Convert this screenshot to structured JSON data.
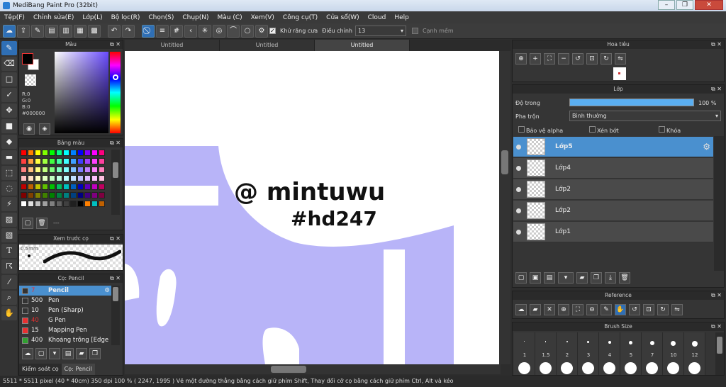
{
  "window": {
    "title": "MediBang Paint Pro (32bit)"
  },
  "menu": [
    "Tệp(F)",
    "Chỉnh sửa(E)",
    "Lớp(L)",
    "Bộ lọc(R)",
    "Chọn(S)",
    "Chụp(N)",
    "Màu (C)",
    "Xem(V)",
    "Công cụ(T)",
    "Cửa sổ(W)",
    "Cloud",
    "Help"
  ],
  "toolbar": {
    "antialias_label": "Khử răng cưa",
    "adjust_label": "Điều chỉnh",
    "adjust_value": "13",
    "edge_label": "Cạnh mềm"
  },
  "color_panel": {
    "title": "Màu",
    "r": "R:0",
    "g": "G:0",
    "b": "B:0",
    "hex": "#000000"
  },
  "palette_panel": {
    "title": "Bảng màu",
    "extra": "---"
  },
  "preview_panel": {
    "title": "Xem trước cọ",
    "size": "0.5mm"
  },
  "brush_panel": {
    "title": "Cọ: Pencil",
    "brushes": [
      {
        "size": "7",
        "name": "Pencil",
        "color": "#333333"
      },
      {
        "size": "500",
        "name": "Pen",
        "color": "#333333"
      },
      {
        "size": "10",
        "name": "Pen (Sharp)",
        "color": "#333333"
      },
      {
        "size": "40",
        "name": "G Pen",
        "color": "#e83030"
      },
      {
        "size": "15",
        "name": "Mapping Pen",
        "color": "#e83030"
      },
      {
        "size": "400",
        "name": "Khoảng trống [Edge",
        "color": "#30a030"
      }
    ],
    "bottom_tabs": [
      "Kiểm soát cọ",
      "Cọ: Pencil"
    ]
  },
  "tabs": [
    "Untitled",
    "Untitled",
    "Untitled"
  ],
  "canvas": {
    "text_line1": "@ mintuwu",
    "text_line2": "#hd247"
  },
  "navigator": {
    "title": "Hoa tiêu"
  },
  "layer_panel": {
    "title": "Lớp",
    "opacity_label": "Độ trong",
    "opacity_value": "100 %",
    "blend_label": "Pha trộn",
    "blend_value": "Bình thường",
    "protect_alpha": "Bảo vệ alpha",
    "clip": "Xén bớt",
    "lock": "Khóa",
    "layers": [
      "Lớp5",
      "Lớp4",
      "Lớp2",
      "Lớp2",
      "Lớp1"
    ]
  },
  "reference_panel": {
    "title": "Reference"
  },
  "brush_size_panel": {
    "title": "Brush Size",
    "sizes": [
      "1",
      "1.5",
      "2",
      "3",
      "4",
      "5",
      "7",
      "10",
      "12"
    ]
  },
  "status": {
    "text": "5511 * 5511 pixel  (40 * 40cm)  350 dpi  100 %  ( 2247, 1995 )  Vẽ một đường thẳng bằng cách giữ phím Shift, Thay đổi cỡ cọ bằng cách giữ phím Ctrl, Alt và kéo"
  },
  "colors": {
    "canvas_lilac": "#b8b4f8",
    "selection_blue": "#4a90cf"
  }
}
